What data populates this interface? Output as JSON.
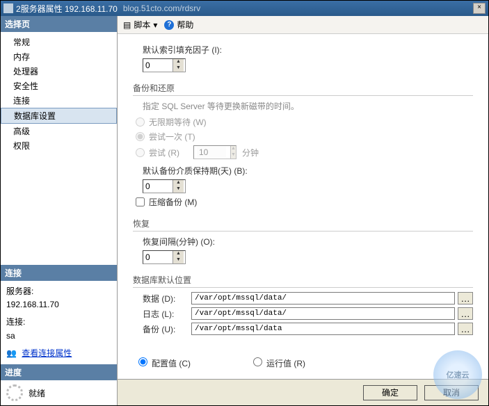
{
  "title": "2服务器属性 192.168.11.70",
  "watermark_url": "blog.51cto.com/rdsrv",
  "left": {
    "select_page": "选择页",
    "items": [
      "常规",
      "内存",
      "处理器",
      "安全性",
      "连接",
      "数据库设置",
      "高级",
      "权限"
    ],
    "selected_index": 5,
    "connection_head": "连接",
    "server_label": "服务器:",
    "server_value": "192.168.11.70",
    "conn_label": "连接:",
    "conn_value": "sa",
    "view_props": "查看连接属性",
    "progress_head": "进度",
    "ready": "就绪"
  },
  "toolbar": {
    "script": "脚本",
    "help": "帮助"
  },
  "main": {
    "fill_factor_label": "默认索引填充因子 (I):",
    "fill_factor_value": "0",
    "backup_restore": "备份和还原",
    "backup_hint": "指定 SQL Server 等待更换新磁带的时间。",
    "wait_inf": "无限期等待 (W)",
    "try_once": "尝试一次 (T)",
    "try": "尝试 (R)",
    "try_value": "10",
    "minutes": "分钟",
    "retention_label": "默认备份介质保持期(天) (B):",
    "retention_value": "0",
    "compress": "压缩备份 (M)",
    "recovery": "恢复",
    "recovery_interval_label": "恢复间隔(分钟) (O):",
    "recovery_interval_value": "0",
    "default_loc": "数据库默认位置",
    "data_lbl": "数据 (D):",
    "data_path": "/var/opt/mssql/data/",
    "log_lbl": "日志 (L):",
    "log_path": "/var/opt/mssql/data/",
    "backup_lbl": "备份 (U):",
    "backup_path": "/var/opt/mssql/data",
    "configured": "配置值 (C)",
    "running": "运行值 (R)"
  },
  "buttons": {
    "ok": "确定",
    "cancel": "取消"
  },
  "watermark": "亿速云"
}
